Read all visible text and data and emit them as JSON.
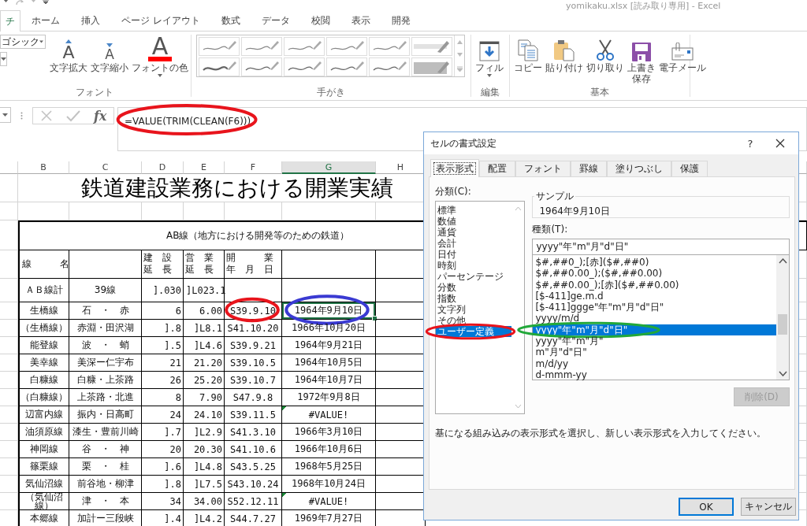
{
  "window": {
    "title": "yomikaku.xlsx [読み取り専用] - Excel"
  },
  "tabs": [
    {
      "label": "チ",
      "selected": true
    },
    {
      "label": "ホーム",
      "selected": false
    },
    {
      "label": "挿入",
      "selected": false
    },
    {
      "label": "ページ レイアウト",
      "selected": false
    },
    {
      "label": "数式",
      "selected": false
    },
    {
      "label": "データ",
      "selected": false
    },
    {
      "label": "校閲",
      "selected": false
    },
    {
      "label": "表示",
      "selected": false
    },
    {
      "label": "開発",
      "selected": false
    }
  ],
  "ribbon": {
    "groups": [
      {
        "label": "フォント",
        "kind": "font",
        "font_name": "ゴシック",
        "buttons": [
          {
            "kind": "grow",
            "glyph": "A",
            "lines": [
              "文字拡大"
            ]
          },
          {
            "kind": "shrink",
            "glyph": "A",
            "lines": [
              "文字縮小"
            ]
          },
          {
            "kind": "font_color",
            "glyph": "A",
            "lines": [
              "フォントの色"
            ]
          }
        ]
      },
      {
        "label": "手がき",
        "kind": "gallery"
      },
      {
        "label": "編集",
        "kind": "buttons",
        "buttons": [
          {
            "kind": "fill",
            "lines": [
              "フィル"
            ]
          }
        ]
      },
      {
        "label": "基本",
        "kind": "buttons",
        "buttons": [
          {
            "kind": "copy",
            "lines": [
              "コピー"
            ]
          },
          {
            "kind": "paste",
            "lines": [
              "貼り付け"
            ]
          },
          {
            "kind": "cut",
            "lines": [
              "切り取り"
            ]
          },
          {
            "kind": "save",
            "lines": [
              "上書き",
              "保存"
            ]
          },
          {
            "kind": "email",
            "lines": [
              "電子メール"
            ]
          }
        ]
      }
    ]
  },
  "formula_bar": {
    "fx_label": "fx",
    "formula": "=VALUE(TRIM(CLEAN(F6)))",
    "highlight": {
      "color": "#e8141c"
    }
  },
  "sheet": {
    "columns": [
      {
        "label": "B",
        "selected": false
      },
      {
        "label": "C",
        "selected": false
      },
      {
        "label": "D",
        "selected": false
      },
      {
        "label": "E",
        "selected": false
      },
      {
        "label": "F",
        "selected": false
      },
      {
        "label": "G",
        "selected": true
      },
      {
        "label": "H",
        "selected": false
      }
    ],
    "title": "鉄道建設業務における開業実績",
    "caption": "AB線（地方における開発等のための鉄道）",
    "header": {
      "line_name": "線　　　名",
      "built_length": [
        "建　設",
        "延　長"
      ],
      "operating_length": [
        "営　業",
        "延　長"
      ],
      "opening_date": [
        "開　　　業",
        "年　月　日"
      ]
    },
    "total": {
      "name": "ＡＢ線計",
      "section": "39線",
      "built": "].030",
      "operating": "]L023.1"
    },
    "rows": [
      {
        "name": "生橋線",
        "section": "石　・　赤",
        "built": "6",
        "operating": "6.00",
        "date": "S39.9.10",
        "result": "1964年9月10日",
        "selected": true,
        "error_flag": false,
        "date_highlight": {
          "color": "#e8141c"
        },
        "result_highlight": {
          "color": "#3a3ad2"
        }
      },
      {
        "name": "（生橋線）",
        "section": "赤淵・田沢湖",
        "built": "].8",
        "operating": "]L8.1",
        "date": "S41.10.20",
        "result": "1966年10月20日",
        "selected": false,
        "error_flag": false
      },
      {
        "name": "能登線",
        "section": "波　・　蛸",
        "built": "].5",
        "operating": "]L4.6",
        "date": "S39.9.21",
        "result": "1964年9月21日",
        "selected": false,
        "error_flag": false
      },
      {
        "name": "美幸線",
        "section": "美深ー仁宇布",
        "built": "21",
        "operating": "21.20",
        "date": "S39.10.5",
        "result": "1964年10月5日",
        "selected": false,
        "error_flag": false
      },
      {
        "name": "白糠線",
        "section": "白糠・上茶路",
        "built": "26",
        "operating": "25.20",
        "date": "S39.10.7",
        "result": "1964年10月7日",
        "selected": false,
        "error_flag": false
      },
      {
        "name": "（白糠線）",
        "section": "上茶路・北進",
        "built": "8",
        "operating": "7.90",
        "date": "S47.9.8",
        "result": "1972年9月8日",
        "selected": false,
        "error_flag": false
      },
      {
        "name": "辺富内線",
        "section": "振内・日高町",
        "built": "24",
        "operating": "24.10",
        "date": "S39.11.5",
        "result": "#VALUE!",
        "selected": false,
        "error_flag": true
      },
      {
        "name": "油須原線",
        "section": "漆生・豊前川崎",
        "built": "].7",
        "operating": "]L2.9",
        "date": "S41.3.10",
        "result": "1966年3月10日",
        "selected": false,
        "error_flag": false
      },
      {
        "name": "神岡線",
        "section": "谷　・　神",
        "built": "20",
        "operating": "20.30",
        "date": "S41.10.6",
        "result": "1966年10月6日",
        "selected": false,
        "error_flag": false
      },
      {
        "name": "篠栗線",
        "section": "栗　・　桂",
        "built": "].6",
        "operating": "]L4.8",
        "date": "S43.5.25",
        "result": "1968年5月25日",
        "selected": false,
        "error_flag": false
      },
      {
        "name": "気仙沼線",
        "section": "前谷地・柳津",
        "built": "].8",
        "operating": "]L7.5",
        "date": "S43.10.24",
        "result": "1968年10月24日",
        "selected": false,
        "error_flag": false
      },
      {
        "name": "（気仙沼線）",
        "section": "津　・　本",
        "built": "34",
        "operating": "34.00",
        "date": "S52.12.11",
        "result": "#VALUE!",
        "selected": false,
        "error_flag": true
      },
      {
        "name": "本郷線",
        "section": "加計ー三段峡",
        "built": "].4",
        "operating": "]L4.2",
        "date": "S44.7.27",
        "result": "1969年7月27日",
        "selected": false,
        "error_flag": false
      }
    ]
  },
  "dialog": {
    "title": "セルの書式設定",
    "help_label": "?",
    "tabs": [
      {
        "label": "表示形式",
        "selected": true
      },
      {
        "label": "配置",
        "selected": false
      },
      {
        "label": "フォント",
        "selected": false
      },
      {
        "label": "罫線",
        "selected": false
      },
      {
        "label": "塗りつぶし",
        "selected": false
      },
      {
        "label": "保護",
        "selected": false
      }
    ],
    "category_label": "分類(C):",
    "categories": [
      {
        "label": "標準",
        "selected": false
      },
      {
        "label": "数値",
        "selected": false
      },
      {
        "label": "通貨",
        "selected": false
      },
      {
        "label": "会計",
        "selected": false
      },
      {
        "label": "日付",
        "selected": false
      },
      {
        "label": "時刻",
        "selected": false
      },
      {
        "label": "パーセンテージ",
        "selected": false
      },
      {
        "label": "分数",
        "selected": false
      },
      {
        "label": "指数",
        "selected": false
      },
      {
        "label": "文字列",
        "selected": false
      },
      {
        "label": "その他",
        "selected": false
      },
      {
        "label": "ユーザー定義",
        "selected": true,
        "highlight": {
          "color": "#e8141c"
        }
      }
    ],
    "sample_label": "サンプル",
    "sample_value": "1964年9月10日",
    "type_label": "種類(T):",
    "type_value": "yyyy\"年\"m\"月\"d\"日\"",
    "formats": [
      {
        "label": "$#,##0_);[赤]($#,##0)",
        "selected": false
      },
      {
        "label": "$#,##0.00_);($#,##0.00)",
        "selected": false
      },
      {
        "label": "$#,##0.00_);[赤]($#,##0.00)",
        "selected": false
      },
      {
        "label": "[$-411]ge.m.d",
        "selected": false
      },
      {
        "label": "[$-411]ggge\"年\"m\"月\"d\"日\"",
        "selected": false
      },
      {
        "label": "yyyy/m/d",
        "selected": false
      },
      {
        "label": "yyyy\"年\"m\"月\"d\"日\"",
        "selected": true,
        "highlight": {
          "color": "#22a83a"
        }
      },
      {
        "label": "yyyy\"年\"m\"月\"",
        "selected": false
      },
      {
        "label": "m\"月\"d\"日\"",
        "selected": false
      },
      {
        "label": "m/d/yy",
        "selected": false
      },
      {
        "label": "d-mmm-yy",
        "selected": false
      }
    ],
    "delete_button": {
      "label": "削除(D)",
      "disabled": true
    },
    "hint": "基になる組み込みの表示形式を選択し、新しい表示形式を入力してください。",
    "ok_label": "OK",
    "cancel_label": "キャンセル"
  }
}
